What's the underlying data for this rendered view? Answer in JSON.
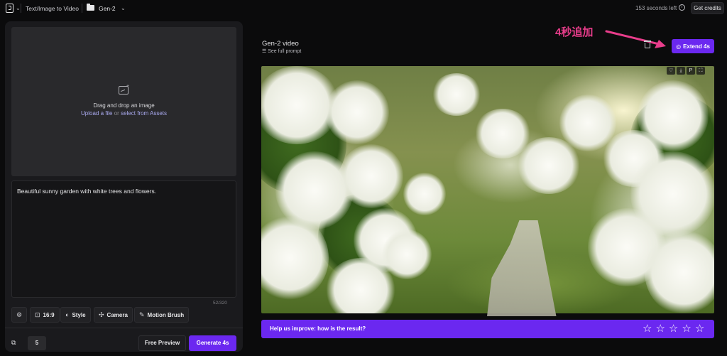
{
  "topbar": {
    "breadcrumb": "Text/Image to Video",
    "project": "Gen-2",
    "seconds_left": "153 seconds left",
    "info_glyph": "i",
    "get_credits": "Get credits"
  },
  "upload": {
    "title": "Drag and drop an image",
    "upload_link": "Upload a file",
    "or": "or",
    "assets_link": "select from Assets"
  },
  "prompt": {
    "text": "Beautiful sunny garden with white trees and flowers.",
    "counter": "52/320"
  },
  "toolbar": {
    "settings_icon": "sliders-icon",
    "aspect": "16:9",
    "style": "Style",
    "camera": "Camera",
    "motion_brush": "Motion Brush"
  },
  "generation": {
    "count": "5",
    "free_preview": "Free Preview",
    "generate": "Generate 4s"
  },
  "video": {
    "title": "Gen-2 video",
    "see_prompt": "See full prompt",
    "extend": "Extend 4s",
    "annotation": "4秒追加",
    "controls": [
      "heart-icon",
      "download-icon",
      "p-icon",
      "fullscreen-icon"
    ],
    "control_glyphs": [
      "♡",
      "⤓",
      "P",
      "⛶"
    ]
  },
  "feedback": {
    "text": "Help us improve: how is the result?",
    "stars": 5
  },
  "colors": {
    "accent": "#6b28f0",
    "annotation": "#e83d8b"
  }
}
